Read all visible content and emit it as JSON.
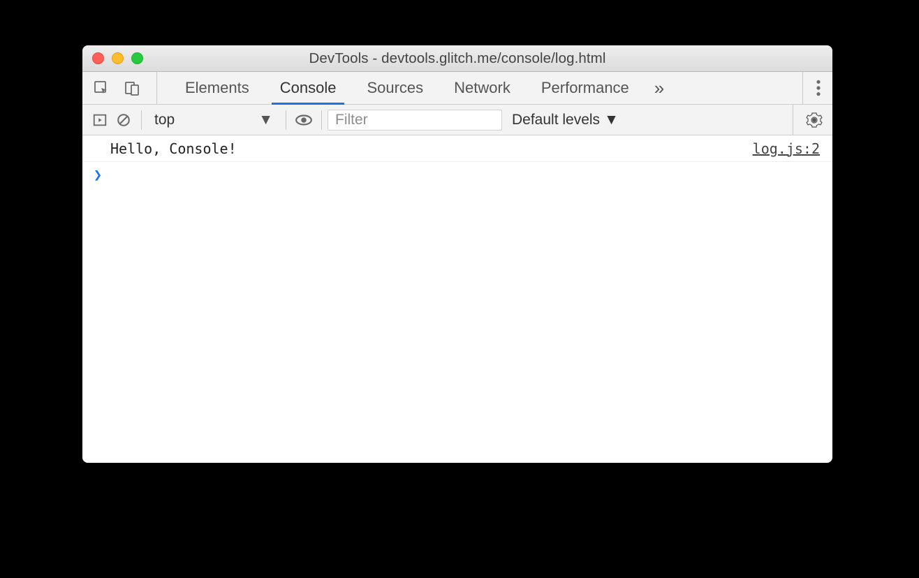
{
  "window": {
    "title": "DevTools - devtools.glitch.me/console/log.html"
  },
  "tabs": {
    "items": [
      "Elements",
      "Console",
      "Sources",
      "Network",
      "Performance"
    ],
    "active": "Console",
    "more": "»"
  },
  "toolbar": {
    "context": "top",
    "filter_placeholder": "Filter",
    "levels": "Default levels"
  },
  "console": {
    "rows": [
      {
        "message": "Hello, Console!",
        "source": "log.js:2"
      }
    ],
    "prompt": ">"
  }
}
